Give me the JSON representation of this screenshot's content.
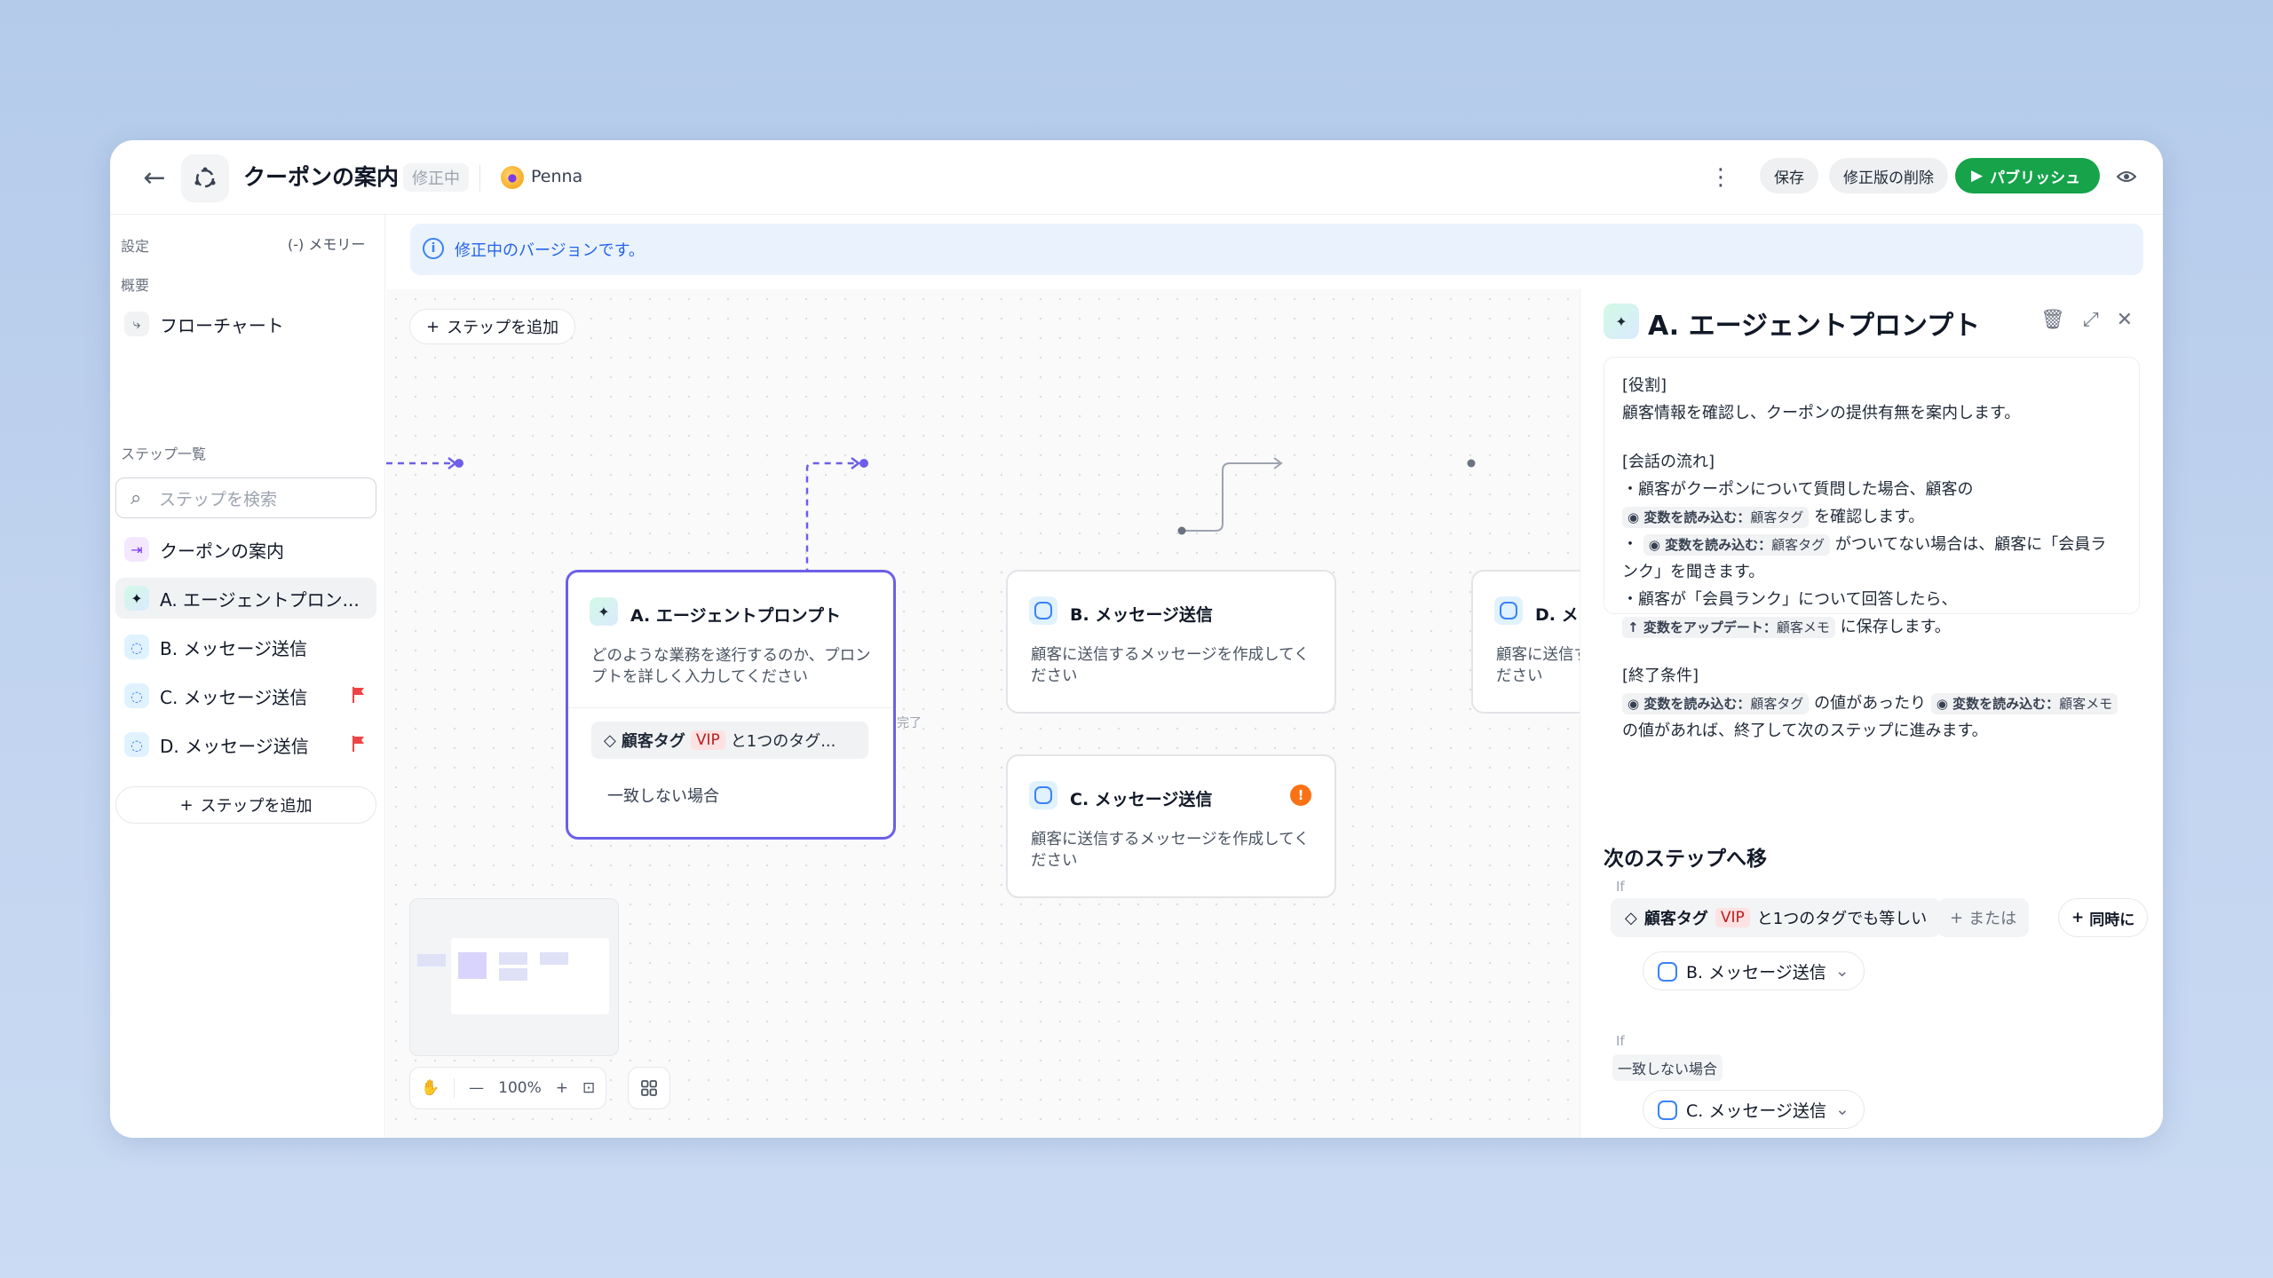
{
  "header": {
    "title": "クーポンの案内",
    "status_badge": "修正中",
    "user_name": "Penna",
    "save_label": "保存",
    "delete_revision_label": "修正版の削除",
    "publish_label": "パブリッシュ"
  },
  "sidebar": {
    "settings_label": "設定",
    "memory_label": "(-) メモリー",
    "overview_label": "概要",
    "flowchart_label": "フローチャート",
    "steps_label": "ステップ一覧",
    "search_placeholder": "ステップを検索",
    "items": [
      {
        "label": "クーポンの案内",
        "icon": "entry-icon"
      },
      {
        "label": "A. エージェントプロン...",
        "icon": "sparkle-icon",
        "active": true
      },
      {
        "label": "B. メッセージ送信",
        "icon": "chat-icon"
      },
      {
        "label": "C. メッセージ送信",
        "icon": "chat-icon",
        "flag": true
      },
      {
        "label": "D. メッセージ送信",
        "icon": "chat-icon",
        "flag": true
      }
    ],
    "add_step_label": "ステップを追加"
  },
  "banner": {
    "text": "修正中のバージョンです。"
  },
  "canvas": {
    "add_step_label": "ステップを追加",
    "nodes": {
      "a": {
        "title": "A. エージェントプロンプト",
        "desc": "どのような業務を遂行するのか、プロンプトを詳しく入力してください",
        "tag_label": "顧客タグ",
        "tag_value": "VIP",
        "tag_suffix": "と1つのタグ...",
        "mismatch": "一致しない場合"
      },
      "b": {
        "title": "B. メッセージ送信",
        "desc": "顧客に送信するメッセージを作成してください"
      },
      "c": {
        "title": "C. メッセージ送信",
        "desc": "顧客に送信するメッセージを作成してください"
      },
      "d": {
        "title": "D. メッセージ送信",
        "desc": "顧客に送信するメッセージを作成してください"
      }
    },
    "done_label": "完了",
    "zoom": "100%"
  },
  "panel": {
    "title": "A. エージェントプロンプト",
    "role_heading": "[役割]",
    "role_text": "顧客情報を確認し、クーポンの提供有無を案内します。",
    "flow_heading": "[会話の流れ]",
    "flow_1a": "・顧客がクーポンについて質問した場合、顧客の",
    "flow_1b": "を確認します。",
    "flow_2a": "・",
    "flow_2b": "がついてない場合は、顧客に「会員ランク」を聞きます。",
    "flow_3a": "・顧客が「会員ランク」について回答したら、",
    "flow_3b": "に保存します。",
    "end_heading": "[終了条件]",
    "end_a": "の値があったり",
    "end_b": "の値があれば、終了して次のステップに進みます。",
    "chip_read": "変数を読み込む：",
    "chip_update": "変数をアップデート：",
    "var_tag": "顧客タグ",
    "var_memo": "顧客メモ",
    "next_title": "次のステップへ移",
    "if_label": "If",
    "cond_tag_label": "顧客タグ",
    "cond_tag_value": "VIP",
    "cond_suffix": "と1つのタグでも等しい",
    "or_label": "または",
    "and_label": "同時に",
    "target_1": "B. メッセージ送信",
    "mismatch_label": "一致しない場合",
    "target_2": "C. メッセージ送信"
  },
  "colors": {
    "accent": "#6d5fe8",
    "publish": "#16a34a",
    "info": "#2563eb",
    "warning": "#f97316",
    "flag": "#ef4444"
  }
}
